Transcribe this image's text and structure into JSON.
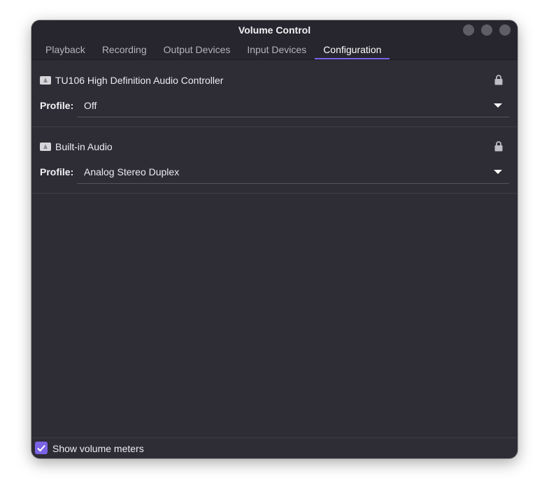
{
  "window": {
    "title": "Volume Control"
  },
  "tabs": [
    {
      "label": "Playback",
      "active": false
    },
    {
      "label": "Recording",
      "active": false
    },
    {
      "label": "Output Devices",
      "active": false
    },
    {
      "label": "Input Devices",
      "active": false
    },
    {
      "label": "Configuration",
      "active": true
    }
  ],
  "cards": [
    {
      "device_name": "TU106 High Definition Audio Controller",
      "profile_label": "Profile:",
      "profile_value": "Off",
      "icon": "audio-card-icon"
    },
    {
      "device_name": "Built-in Audio",
      "profile_label": "Profile:",
      "profile_value": "Analog Stereo Duplex",
      "icon": "audio-card-icon"
    }
  ],
  "footer": {
    "show_volume_meters_label": "Show volume meters",
    "show_volume_meters_checked": true
  },
  "colors": {
    "window_bg": "#2e2d36",
    "titlebar_bg": "#27262e",
    "accent": "#7b63e6",
    "text": "#ececf0",
    "window_button": "#5f5e66"
  }
}
